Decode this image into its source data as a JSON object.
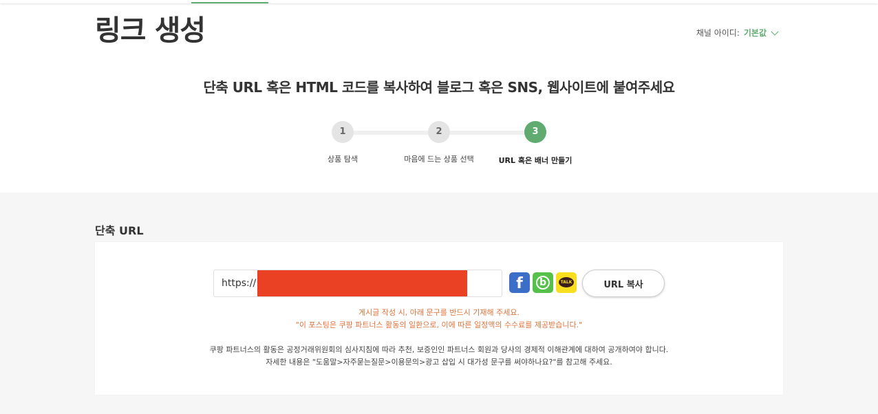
{
  "page": {
    "title": "링크 생성"
  },
  "channel": {
    "label": "채널 아이디:",
    "value": "기본값"
  },
  "headline": "단축 URL 혹은 HTML 코드를 복사하여 블로그 혹은 SNS, 웹사이트에 붙여주세요",
  "steps": [
    {
      "number": "1",
      "label": "상품 탐색"
    },
    {
      "number": "2",
      "label": "마음에 드는 상품 선택"
    },
    {
      "number": "3",
      "label": "URL 혹은 배너 만들기"
    }
  ],
  "short_url": {
    "section_title": "단축 URL",
    "url_value": "https://",
    "copy_button": "URL 복사",
    "sns": {
      "facebook": "f",
      "band": "b",
      "kakaotalk": "TALK"
    },
    "notice_line1": "게시글 작성 시, 아래 문구를 반드시 기재해 주세요.",
    "notice_line2": "\"이 포스팅은 쿠팡 파트너스 활동의 일환으로, 이에 따른 일정액의 수수료를 제공받습니다.\"",
    "info_line1": "쿠팡 파트너스의 활동은 공정거래위원회의 심사지침에 따라 추천, 보증인인 파트너스 회원과 당사의 경제적 이해관계에 대하여 공개하여야 합니다.",
    "info_line2": "자세한 내용은 \"도움말>자주묻는질문>이용문의>광고 삽입 시 대가성 문구를 써야하나요?\"를 참고해 주세요."
  },
  "colors": {
    "accent": "#5fab70",
    "notice": "#e0733b",
    "redaction": "#ea4125",
    "facebook": "#3b6ec6",
    "band": "#56c14a",
    "kakaotalk": "#f7de1e"
  },
  "icons": {
    "facebook": "facebook-icon",
    "band": "band-icon",
    "kakaotalk": "kakaotalk-icon",
    "dropdown": "chevron-down-icon"
  }
}
